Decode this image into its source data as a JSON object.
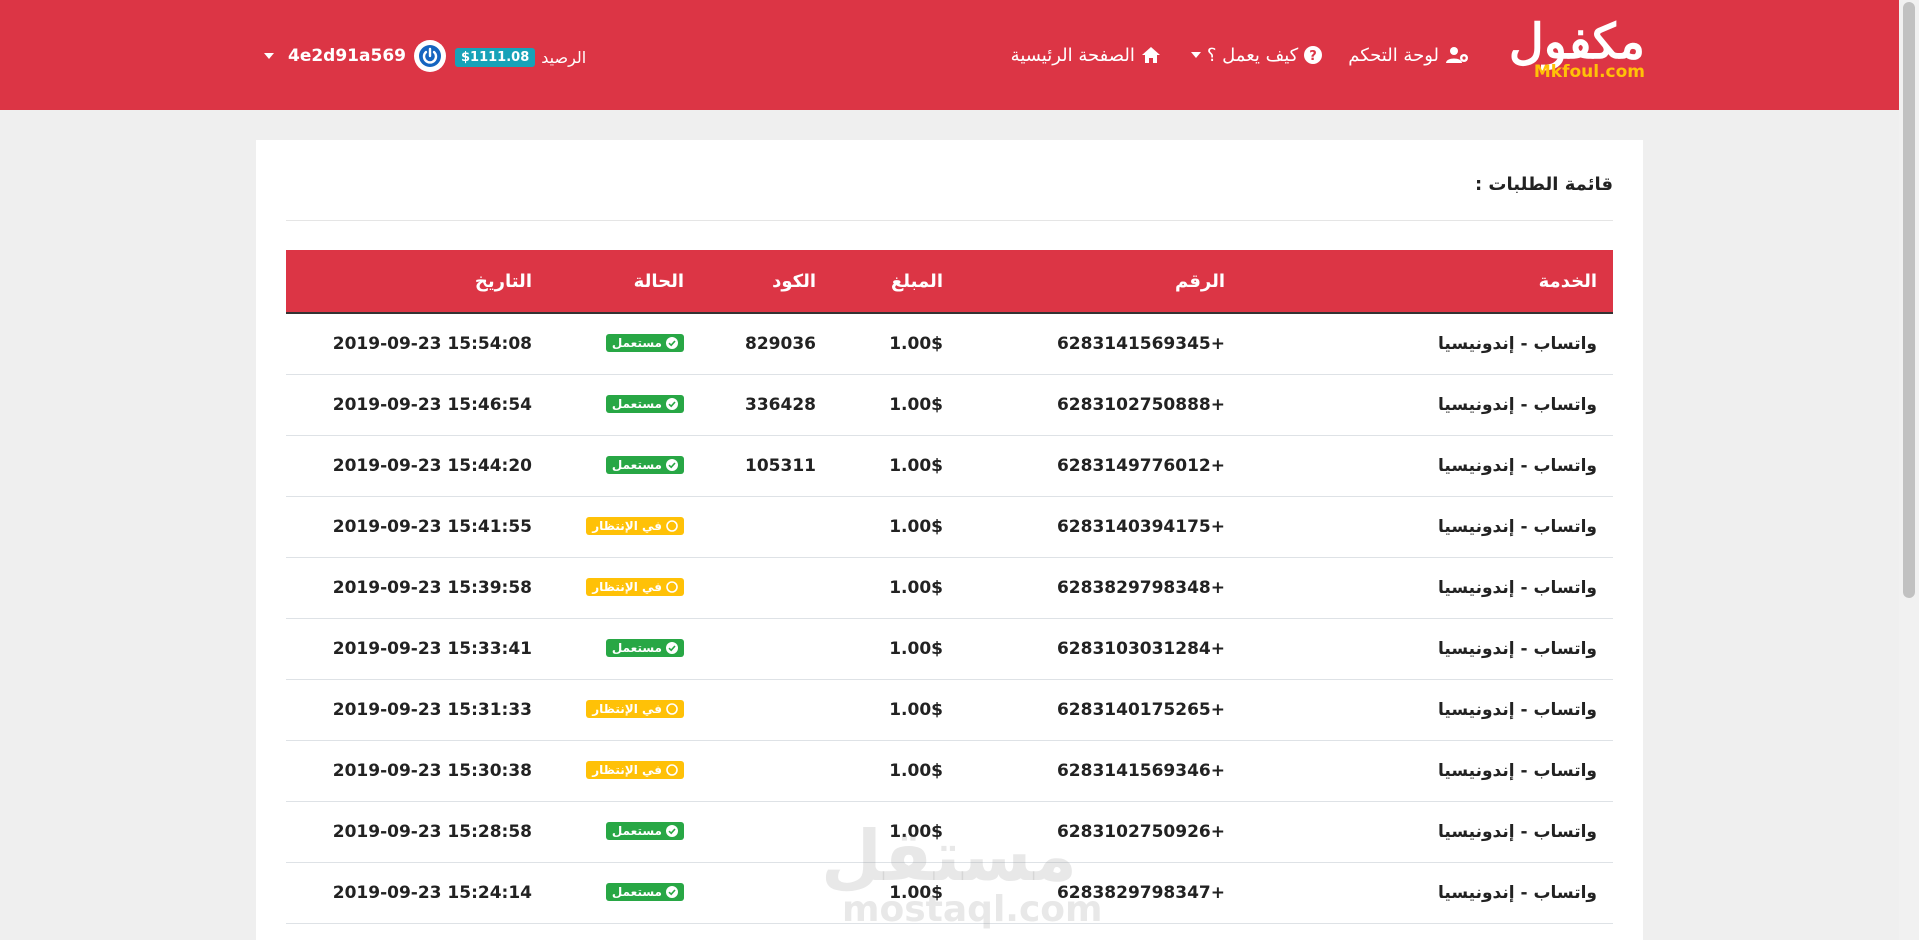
{
  "header": {
    "logo_ar": "مكفول",
    "logo_en": "Mkfoul.com",
    "nav": {
      "home": "الصفحة الرئيسية",
      "how": "كيف يعمل ؟",
      "dashboard": "لوحة التحكم"
    },
    "balance_label": "الرصيد",
    "balance_value": "$1111.08",
    "username": "4e2d91a569"
  },
  "card": {
    "title": "قائمة الطلبات :",
    "columns": [
      "الخدمة",
      "الرقم",
      "المبلغ",
      "الكود",
      "الحالة",
      "التاريخ"
    ],
    "rows": [
      {
        "service": "واتساب - إندونيسيا",
        "number": "6283141569345+",
        "amount": "1.00$",
        "code": "829036",
        "status": "مستعمل",
        "status_type": "used",
        "date": "2019-09-23 15:54:08"
      },
      {
        "service": "واتساب - إندونيسيا",
        "number": "6283102750888+",
        "amount": "1.00$",
        "code": "336428",
        "status": "مستعمل",
        "status_type": "used",
        "date": "2019-09-23 15:46:54"
      },
      {
        "service": "واتساب - إندونيسيا",
        "number": "6283149776012+",
        "amount": "1.00$",
        "code": "105311",
        "status": "مستعمل",
        "status_type": "used",
        "date": "2019-09-23 15:44:20"
      },
      {
        "service": "واتساب - إندونيسيا",
        "number": "6283140394175+",
        "amount": "1.00$",
        "code": "",
        "status": "في الإنتظار",
        "status_type": "pending",
        "date": "2019-09-23 15:41:55"
      },
      {
        "service": "واتساب - إندونيسيا",
        "number": "6283829798348+",
        "amount": "1.00$",
        "code": "",
        "status": "في الإنتظار",
        "status_type": "pending",
        "date": "2019-09-23 15:39:58"
      },
      {
        "service": "واتساب - إندونيسيا",
        "number": "6283103031284+",
        "amount": "1.00$",
        "code": "",
        "status": "مستعمل",
        "status_type": "used",
        "date": "2019-09-23 15:33:41"
      },
      {
        "service": "واتساب - إندونيسيا",
        "number": "6283140175265+",
        "amount": "1.00$",
        "code": "",
        "status": "في الإنتظار",
        "status_type": "pending",
        "date": "2019-09-23 15:31:33"
      },
      {
        "service": "واتساب - إندونيسيا",
        "number": "6283141569346+",
        "amount": "1.00$",
        "code": "",
        "status": "في الإنتظار",
        "status_type": "pending",
        "date": "2019-09-23 15:30:38"
      },
      {
        "service": "واتساب - إندونيسيا",
        "number": "6283102750926+",
        "amount": "1.00$",
        "code": "",
        "status": "مستعمل",
        "status_type": "used",
        "date": "2019-09-23 15:28:58"
      },
      {
        "service": "واتساب - إندونيسيا",
        "number": "6283829798347+",
        "amount": "1.00$",
        "code": "",
        "status": "مستعمل",
        "status_type": "used",
        "date": "2019-09-23 15:24:14"
      }
    ]
  },
  "watermark": {
    "ar": "مستقل",
    "en": "mostaql.com"
  },
  "colors": {
    "primary": "#dc3545",
    "used": "#28a745",
    "pending": "#ffc107",
    "balance": "#17a2b8",
    "accent": "#1565c0"
  },
  "icons": {
    "home": "home-icon",
    "how": "question-circle-icon",
    "dashboard": "user-gear-icon",
    "power": "power-icon",
    "check": "check-circle-icon",
    "pending": "circle-icon"
  }
}
